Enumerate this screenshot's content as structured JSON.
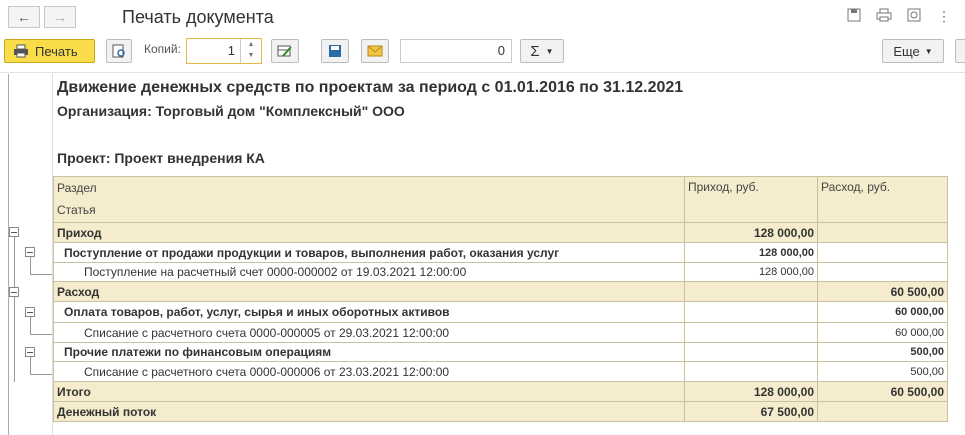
{
  "window": {
    "title": "Печать документа",
    "back": "←",
    "forward": "→",
    "icons": [
      "save-icon",
      "print-icon",
      "preview-icon",
      "more-icon"
    ]
  },
  "toolbar": {
    "print_label": "Печать",
    "copies_label": "Копий:",
    "copies_value": "1",
    "sum_value": "0",
    "sigma": "Σ",
    "more_label": "Еще"
  },
  "report": {
    "title": "Движение денежных средств по проектам за период с 01.01.2016 по 31.12.2021",
    "organization": "Организация: Торговый дом \"Комплексный\" ООО",
    "project": "Проект: Проект внедрения КА",
    "headers": {
      "section": "Раздел",
      "article": "Статья",
      "income": "Приход, руб.",
      "expense": "Расход, руб."
    },
    "rows": [
      {
        "level": 0,
        "label": "Приход",
        "income": "128 000,00",
        "expense": ""
      },
      {
        "level": 1,
        "label": "Поступление от продажи продукции и товаров, выполнения работ, оказания услуг",
        "income": "128 000,00",
        "expense": ""
      },
      {
        "level": 2,
        "label": "Поступление на расчетный счет 0000-000002 от 19.03.2021 12:00:00",
        "income": "128 000,00",
        "expense": ""
      },
      {
        "level": 0,
        "label": "Расход",
        "income": "",
        "expense": "60 500,00"
      },
      {
        "level": 1,
        "label": "Оплата товаров, работ, услуг, сырья и иных оборотных активов",
        "income": "",
        "expense": "60 000,00"
      },
      {
        "level": 2,
        "label": "Списание с расчетного счета 0000-000005 от 29.03.2021 12:00:00",
        "income": "",
        "expense": "60 000,00"
      },
      {
        "level": 1,
        "label": "Прочие платежи по финансовым операциям",
        "income": "",
        "expense": "500,00"
      },
      {
        "level": 2,
        "label": "Списание с расчетного счета 0000-000006 от 23.03.2021 12:00:00",
        "income": "",
        "expense": "500,00"
      },
      {
        "level": 0,
        "label": "Итого",
        "income": "128 000,00",
        "expense": "60 500,00"
      },
      {
        "level": 0,
        "label": "Денежный поток",
        "income": "67 500,00",
        "expense": ""
      }
    ]
  }
}
